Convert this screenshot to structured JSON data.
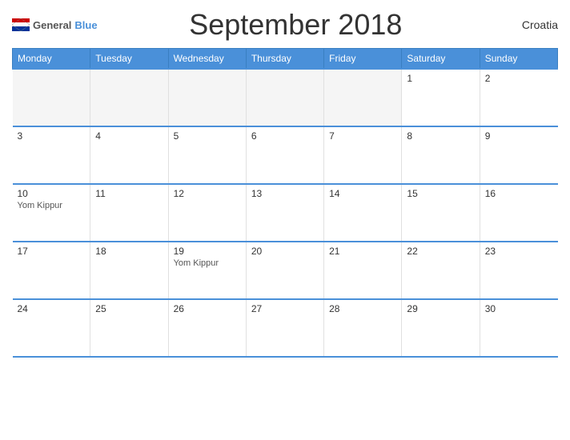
{
  "header": {
    "logo_general": "General",
    "logo_blue": "Blue",
    "title": "September 2018",
    "country": "Croatia"
  },
  "weekdays": [
    "Monday",
    "Tuesday",
    "Wednesday",
    "Thursday",
    "Friday",
    "Saturday",
    "Sunday"
  ],
  "rows": [
    [
      {
        "day": "",
        "event": "",
        "empty": true
      },
      {
        "day": "",
        "event": "",
        "empty": true
      },
      {
        "day": "",
        "event": "",
        "empty": true
      },
      {
        "day": "",
        "event": "",
        "empty": true
      },
      {
        "day": "",
        "event": "",
        "empty": true
      },
      {
        "day": "1",
        "event": ""
      },
      {
        "day": "2",
        "event": ""
      }
    ],
    [
      {
        "day": "3",
        "event": ""
      },
      {
        "day": "4",
        "event": ""
      },
      {
        "day": "5",
        "event": ""
      },
      {
        "day": "6",
        "event": ""
      },
      {
        "day": "7",
        "event": ""
      },
      {
        "day": "8",
        "event": ""
      },
      {
        "day": "9",
        "event": ""
      }
    ],
    [
      {
        "day": "10",
        "event": "Yom Kippur"
      },
      {
        "day": "11",
        "event": ""
      },
      {
        "day": "12",
        "event": ""
      },
      {
        "day": "13",
        "event": ""
      },
      {
        "day": "14",
        "event": ""
      },
      {
        "day": "15",
        "event": ""
      },
      {
        "day": "16",
        "event": ""
      }
    ],
    [
      {
        "day": "17",
        "event": ""
      },
      {
        "day": "18",
        "event": ""
      },
      {
        "day": "19",
        "event": "Yom Kippur"
      },
      {
        "day": "20",
        "event": ""
      },
      {
        "day": "21",
        "event": ""
      },
      {
        "day": "22",
        "event": ""
      },
      {
        "day": "23",
        "event": ""
      }
    ],
    [
      {
        "day": "24",
        "event": ""
      },
      {
        "day": "25",
        "event": ""
      },
      {
        "day": "26",
        "event": ""
      },
      {
        "day": "27",
        "event": ""
      },
      {
        "day": "28",
        "event": ""
      },
      {
        "day": "29",
        "event": ""
      },
      {
        "day": "30",
        "event": ""
      }
    ]
  ]
}
